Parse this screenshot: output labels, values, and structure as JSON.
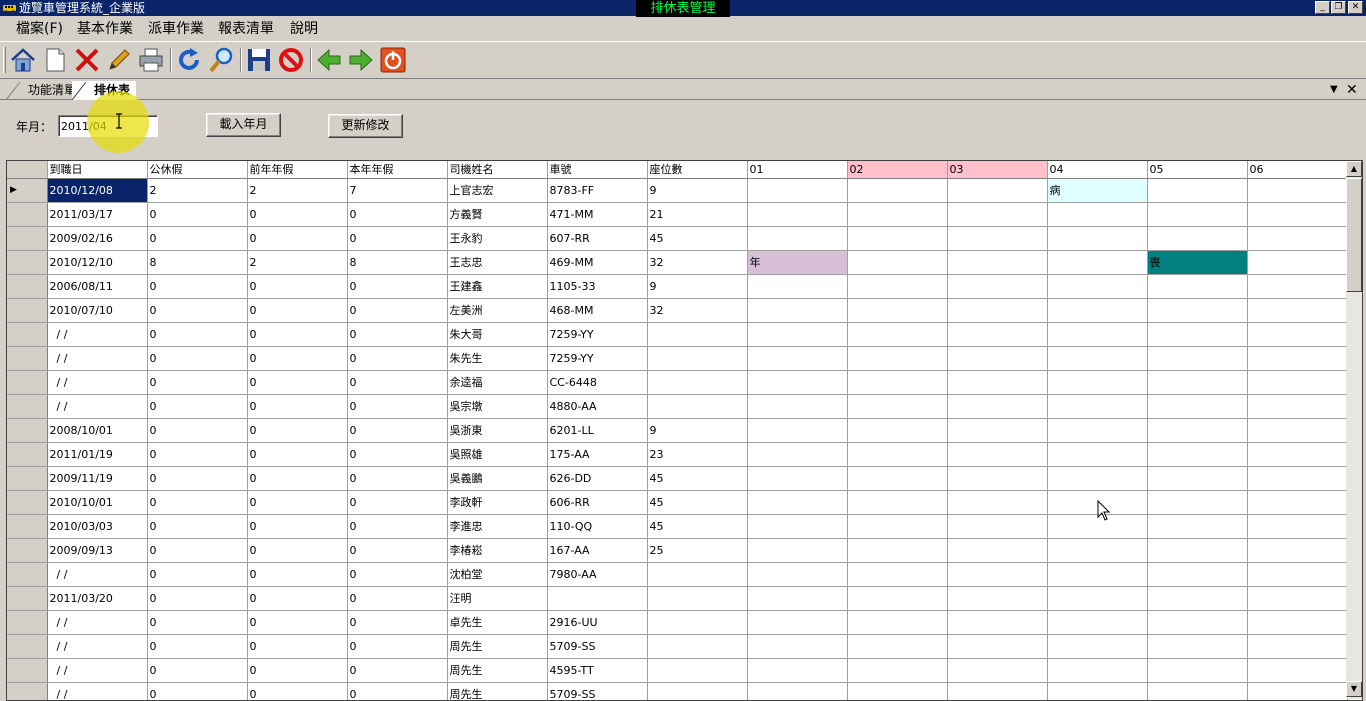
{
  "window": {
    "app_title": "遊覽車管理系統_企業版",
    "center_title": "排休表管理",
    "controls": [
      "_",
      "❐",
      "✕"
    ]
  },
  "menu": [
    "檔案(F)",
    "基本作業",
    "派車作業",
    "報表清單",
    "說明"
  ],
  "toolbar": {
    "buttons": [
      "home-icon",
      "new-document-icon",
      "delete-icon",
      "edit-pencil-icon",
      "print-icon",
      "refresh-icon",
      "search-magnifier-icon",
      "save-disk-icon",
      "cancel-icon",
      "back-arrow-icon",
      "forward-arrow-icon",
      "exit-power-icon"
    ]
  },
  "tabs": [
    {
      "label": "功能清單",
      "active": false
    },
    {
      "label": "排休表",
      "active": true
    }
  ],
  "tab_controls": {
    "dropdown": "▼",
    "close": "✕"
  },
  "filter": {
    "label": "年月：",
    "value": "2011/04",
    "load_button": "載入年月",
    "update_button": "更新修改"
  },
  "grid": {
    "current_row_marker": "▶",
    "columns": [
      "到職日",
      "公休假",
      "前年年假",
      "本年年假",
      "司機姓名",
      "車號",
      "座位數",
      "01",
      "02",
      "03",
      "04",
      "05",
      "06"
    ],
    "highlighted_days": [
      "02",
      "03"
    ],
    "rows": [
      {
        "date": "2010/12/08",
        "off": "2",
        "prev": "2",
        "curr": "7",
        "name": "上官志宏",
        "plate": "8783-FF",
        "seats": "9",
        "days": {
          "04": "病"
        }
      },
      {
        "date": "2011/03/17",
        "off": "0",
        "prev": "0",
        "curr": "0",
        "name": "方義賢",
        "plate": "471-MM",
        "seats": "21",
        "days": {}
      },
      {
        "date": "2009/02/16",
        "off": "0",
        "prev": "0",
        "curr": "0",
        "name": "王永豹",
        "plate": "607-RR",
        "seats": "45",
        "days": {}
      },
      {
        "date": "2010/12/10",
        "off": "8",
        "prev": "2",
        "curr": "8",
        "name": "王志忠",
        "plate": "469-MM",
        "seats": "32",
        "days": {
          "01": "年",
          "05": "喪"
        }
      },
      {
        "date": "2006/08/11",
        "off": "0",
        "prev": "0",
        "curr": "0",
        "name": "王建鑫",
        "plate": "1105-33",
        "seats": "9",
        "days": {}
      },
      {
        "date": "2010/07/10",
        "off": "0",
        "prev": "0",
        "curr": "0",
        "name": "左美洲",
        "plate": "468-MM",
        "seats": "32",
        "days": {}
      },
      {
        "date": "  / /",
        "off": "0",
        "prev": "0",
        "curr": "0",
        "name": "朱大哥",
        "plate": "7259-YY",
        "seats": "",
        "days": {}
      },
      {
        "date": "  / /",
        "off": "0",
        "prev": "0",
        "curr": "0",
        "name": "朱先生",
        "plate": "7259-YY",
        "seats": "",
        "days": {}
      },
      {
        "date": "  / /",
        "off": "0",
        "prev": "0",
        "curr": "0",
        "name": "余逵福",
        "plate": "CC-6448",
        "seats": "",
        "days": {}
      },
      {
        "date": "  / /",
        "off": "0",
        "prev": "0",
        "curr": "0",
        "name": "吳宗墩",
        "plate": "4880-AA",
        "seats": "",
        "days": {}
      },
      {
        "date": "2008/10/01",
        "off": "0",
        "prev": "0",
        "curr": "0",
        "name": "吳浙東",
        "plate": "6201-LL",
        "seats": "9",
        "days": {}
      },
      {
        "date": "2011/01/19",
        "off": "0",
        "prev": "0",
        "curr": "0",
        "name": "吳照雄",
        "plate": "175-AA",
        "seats": "23",
        "days": {}
      },
      {
        "date": "2009/11/19",
        "off": "0",
        "prev": "0",
        "curr": "0",
        "name": "吳義鵬",
        "plate": "626-DD",
        "seats": "45",
        "days": {}
      },
      {
        "date": "2010/10/01",
        "off": "0",
        "prev": "0",
        "curr": "0",
        "name": "李政軒",
        "plate": "606-RR",
        "seats": "45",
        "days": {}
      },
      {
        "date": "2010/03/03",
        "off": "0",
        "prev": "0",
        "curr": "0",
        "name": "李進忠",
        "plate": "110-QQ",
        "seats": "45",
        "days": {}
      },
      {
        "date": "2009/09/13",
        "off": "0",
        "prev": "0",
        "curr": "0",
        "name": "李椿崧",
        "plate": "167-AA",
        "seats": "25",
        "days": {}
      },
      {
        "date": "  / /",
        "off": "0",
        "prev": "0",
        "curr": "0",
        "name": "沈柏堂",
        "plate": "7980-AA",
        "seats": "",
        "days": {}
      },
      {
        "date": "2011/03/20",
        "off": "0",
        "prev": "0",
        "curr": "0",
        "name": "汪明",
        "plate": "",
        "seats": "",
        "days": {}
      },
      {
        "date": "  / /",
        "off": "0",
        "prev": "0",
        "curr": "0",
        "name": "卓先生",
        "plate": "2916-UU",
        "seats": "",
        "days": {}
      },
      {
        "date": "  / /",
        "off": "0",
        "prev": "0",
        "curr": "0",
        "name": "周先生",
        "plate": "5709-SS",
        "seats": "",
        "days": {}
      },
      {
        "date": "  / /",
        "off": "0",
        "prev": "0",
        "curr": "0",
        "name": "周先生",
        "plate": "4595-TT",
        "seats": "",
        "days": {}
      },
      {
        "date": "  / /",
        "off": "0",
        "prev": "0",
        "curr": "0",
        "name": "周先生",
        "plate": "5709-SS",
        "seats": "",
        "days": {}
      }
    ],
    "leave_colors": {
      "病": "#e0ffff",
      "年": "#d8bfd8",
      "喪": "#008080"
    },
    "day_header_highlight": "#ffc0cb",
    "selection_color": "#0a246a"
  },
  "scrollbar": {
    "up": "▲",
    "down": "▼"
  }
}
